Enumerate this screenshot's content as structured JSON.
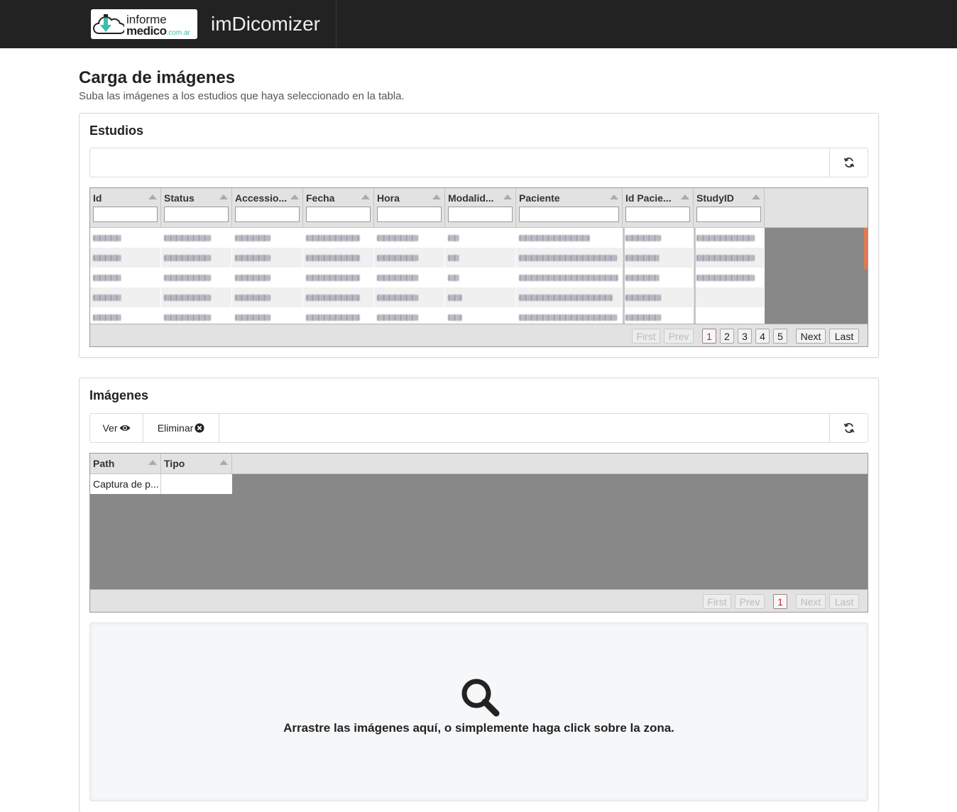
{
  "app": {
    "logo": {
      "line1": "informe",
      "line2": "medico",
      "domain": ".com.ar"
    },
    "title": "imDicomizer"
  },
  "page": {
    "title": "Carga de imágenes",
    "subtitle": "Suba las imágenes a los estudios que haya seleccionado en la tabla."
  },
  "studies": {
    "title": "Estudios",
    "refresh_icon": "refresh-icon",
    "columns": [
      "Id",
      "Status",
      "Accessio...",
      "Fecha",
      "Hora",
      "Modalid...",
      "Paciente",
      "Id Pacie...",
      "StudyID"
    ],
    "rows_note": "cell values blurred in screenshot",
    "pagination": {
      "first": "First",
      "prev": "Prev",
      "pages": [
        "1",
        "2",
        "3",
        "4",
        "5"
      ],
      "current": "1",
      "next": "Next",
      "last": "Last"
    }
  },
  "images": {
    "title": "Imágenes",
    "toolbar": {
      "view_label": "Ver",
      "view_icon": "eye-icon",
      "delete_label": "Eliminar",
      "delete_icon": "remove-circle-icon",
      "refresh_icon": "refresh-icon"
    },
    "columns": [
      "Path",
      "Tipo"
    ],
    "rows": [
      {
        "path": "Captura de p...",
        "tipo": ""
      }
    ],
    "pagination": {
      "first": "First",
      "prev": "Prev",
      "pages": [
        "1"
      ],
      "current": "1",
      "next": "Next",
      "last": "Last"
    }
  },
  "dropzone": {
    "icon": "search-icon",
    "text": "Arrastre las imágenes aquí, o simplemente haga click sobre la zona."
  },
  "colors": {
    "navbar": "#222222",
    "grid_bg": "#888888",
    "active_page": "#cc1f1f",
    "scroll_accent": "#e07a50"
  }
}
